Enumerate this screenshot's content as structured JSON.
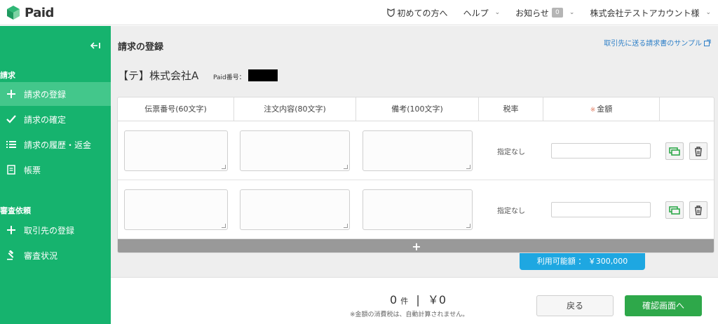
{
  "app": {
    "logo_text": "Paid"
  },
  "topnav": {
    "guide": "初めての方へ",
    "help": "ヘルプ",
    "notices": "お知らせ",
    "notices_count": "0",
    "account": "株式会社テストアカウント様"
  },
  "sidebar": {
    "section_billing": "請求",
    "section_screening": "審査依頼",
    "items": [
      {
        "label": "請求の登録",
        "icon": "plus-icon",
        "active": true
      },
      {
        "label": "請求の確定",
        "icon": "check-icon"
      },
      {
        "label": "請求の履歴・返金",
        "icon": "list-icon"
      },
      {
        "label": "帳票",
        "icon": "document-icon"
      },
      {
        "label": "取引先の登録",
        "icon": "plus-icon"
      },
      {
        "label": "審査状況",
        "icon": "gavel-icon"
      }
    ]
  },
  "main": {
    "title": "請求の登録",
    "sample_link": "取引先に送る請求書のサンプル",
    "client_name": "【テ】株式会社A",
    "paid_no_label": "Paid番号：",
    "table": {
      "headers": [
        "伝票番号(60文字)",
        "注文内容(80文字)",
        "備考(100文字)",
        "税率",
        "金額",
        ""
      ],
      "required_mark": "※",
      "rows": [
        {
          "slip_no": "",
          "order": "",
          "note": "",
          "tax": "指定なし",
          "amount": ""
        },
        {
          "slip_no": "",
          "order": "",
          "note": "",
          "tax": "指定なし",
          "amount": ""
        }
      ],
      "add_row": "+"
    },
    "available": "利用可能額 ： ￥300,000"
  },
  "footer": {
    "count": "0",
    "count_unit": "件",
    "separator": "|",
    "total": "￥0",
    "note": "※金額の消費税は、自動計算されません。",
    "back": "戻る",
    "confirm": "確認画面へ"
  },
  "colors": {
    "sidebar": "#16b36e",
    "sidebar_active": "#43c78b",
    "confirm": "#2ea84a",
    "available": "#1ea7e1",
    "link": "#2f80c8"
  }
}
